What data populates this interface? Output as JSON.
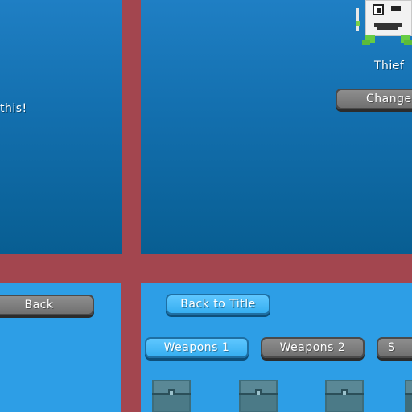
{
  "top_left_panel": {
    "message": "this!"
  },
  "character": {
    "name": "Thief",
    "change_label": "Change"
  },
  "bottom_left_panel": {
    "back_label": "Back"
  },
  "bottom_right_panel": {
    "back_to_title_label": "Back to Title",
    "tabs": [
      {
        "label": "Weapons 1",
        "selected": true
      },
      {
        "label": "Weapons 2",
        "selected": false
      },
      {
        "label": "S",
        "selected": false
      }
    ],
    "item_icons": [
      "chest-icon",
      "chest-icon",
      "chest-icon"
    ]
  },
  "colors": {
    "divider": "#a3464f",
    "panel_top": "#136fae",
    "panel_bottom": "#2d9ee6",
    "button_gray": "#7c7c7c",
    "button_blue": "#45b9f5"
  }
}
